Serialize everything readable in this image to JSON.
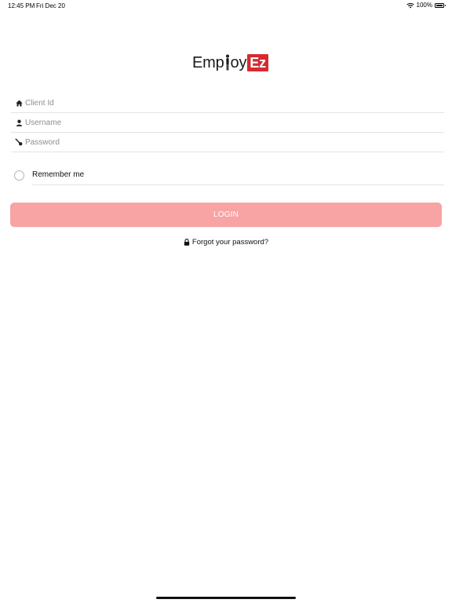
{
  "status_bar": {
    "time": "12:45 PM",
    "date": "Fri Dec 20",
    "battery": "100%",
    "battery_level": 1.0
  },
  "logo": {
    "text_part1": "Emp",
    "text_part2": "oy",
    "text_box": "Ez",
    "brand_color": "#d62a2f"
  },
  "form": {
    "client_id": {
      "placeholder": "Client Id",
      "value": "",
      "icon": "home-icon"
    },
    "username": {
      "placeholder": "Username",
      "value": "",
      "icon": "user-icon"
    },
    "password": {
      "placeholder": "Password",
      "value": "",
      "icon": "key-icon"
    },
    "remember_me": {
      "label": "Remember me",
      "checked": false
    }
  },
  "login_button": {
    "label": "LOGIN",
    "color": "#f8a3a4"
  },
  "forgot": {
    "label": "Forgot your password?",
    "icon": "lock-icon"
  }
}
